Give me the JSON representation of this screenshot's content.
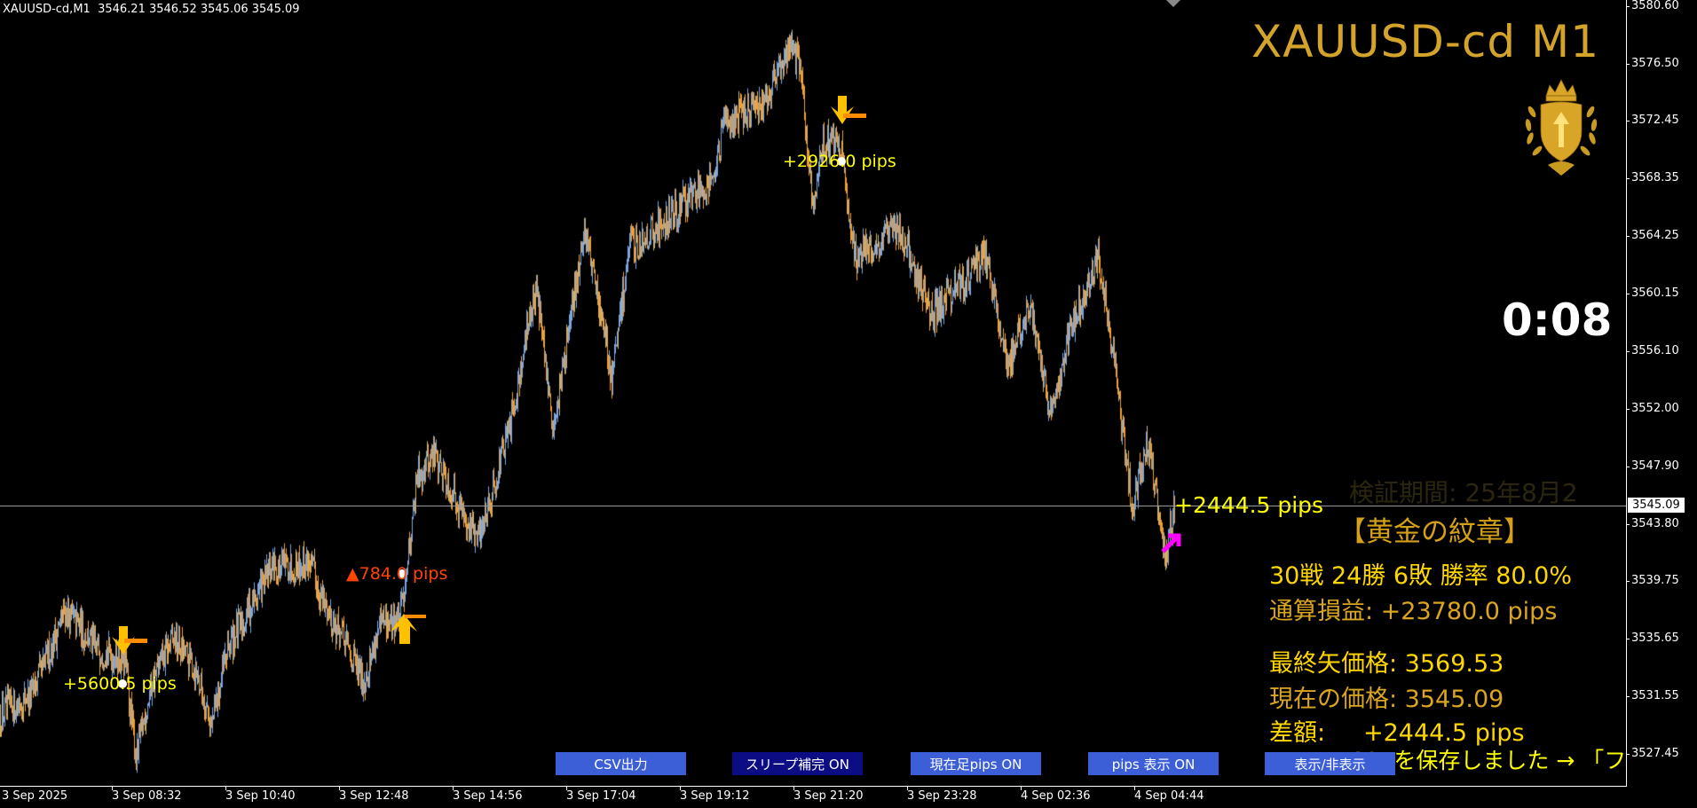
{
  "header": {
    "symbol": "XAUUSD-cd,M1",
    "ohlc": "3546.21 3546.52 3545.06 3545.09"
  },
  "title": "XAUUSD-cd M1",
  "timer": "0:08",
  "current_price": "3545.09",
  "price_axis": [
    "3580.60",
    "3576.50",
    "3572.45",
    "3568.35",
    "3564.25",
    "3560.15",
    "3556.10",
    "3552.00",
    "3547.90",
    "3543.80",
    "3539.75",
    "3535.65",
    "3531.55",
    "3527.45"
  ],
  "time_axis": [
    "3 Sep 2025",
    "3 Sep 08:32",
    "3 Sep 10:40",
    "3 Sep 12:48",
    "3 Sep 14:56",
    "3 Sep 17:04",
    "3 Sep 19:12",
    "3 Sep 21:20",
    "3 Sep 23:28",
    "4 Sep 02:36",
    "4 Sep 04:44"
  ],
  "signals": [
    {
      "type": "sell",
      "label": "+5600.5 pips",
      "color": "#ffff00"
    },
    {
      "type": "buy",
      "label": "▲784.0 pips",
      "color": "#ff4500"
    },
    {
      "type": "sell",
      "label": "+2926.0 pips",
      "color": "#ffff00"
    },
    {
      "type": "current",
      "label": "+2444.5 pips",
      "color": "#ffff00"
    }
  ],
  "faded_text": "検証期間: 25年8月2",
  "panel": {
    "heading": "【黄金の紋章】",
    "record": "30戦 24勝 6敗  勝率 80.0%",
    "total": "通算損益:  +23780.0 pips",
    "last_arrow_price": "最終矢価格: 3569.53",
    "current_price": "現在の価格: 3545.09",
    "diff": "差額:     +2444.5 pips",
    "csv_message": "CSVを保存しました → 「ファイル"
  },
  "buttons": [
    {
      "label": "CSV出力",
      "active": false
    },
    {
      "label": "スリープ補完 ON",
      "active": true
    },
    {
      "label": "現在足pips ON",
      "active": false
    },
    {
      "label": "pips 表示  ON",
      "active": false
    },
    {
      "label": "表示/非表示",
      "active": false
    }
  ],
  "colors": {
    "up_bar": "#7ea6e0",
    "down_bar": "#f0a030",
    "gold": "#d4a42a",
    "yellow": "#ffd700",
    "button": "#3c5fd8",
    "button_active": "#0c0c84",
    "buy_arrow": "#ffc000",
    "entry_arrow": "#ff00ff"
  },
  "chart_data": {
    "type": "candlestick",
    "ylim": [
      3525.4,
      3580.6
    ],
    "x_unit": "bar (M1)",
    "points": [
      [
        0,
        3530.3
      ],
      [
        37,
        3531.8
      ],
      [
        73,
        3537.6
      ],
      [
        110,
        3534.9
      ],
      [
        140,
        3534.1
      ],
      [
        153,
        3527.2
      ],
      [
        171,
        3532.6
      ],
      [
        195,
        3535.6
      ],
      [
        220,
        3533.4
      ],
      [
        238,
        3529.5
      ],
      [
        256,
        3534.9
      ],
      [
        305,
        3540.6
      ],
      [
        348,
        3541.1
      ],
      [
        366,
        3538.0
      ],
      [
        409,
        3532.6
      ],
      [
        427,
        3536.4
      ],
      [
        451,
        3537.2
      ],
      [
        470,
        3547.2
      ],
      [
        488,
        3548.8
      ],
      [
        537,
        3542.6
      ],
      [
        573,
        3550.3
      ],
      [
        604,
        3561.1
      ],
      [
        622,
        3550.3
      ],
      [
        659,
        3564.9
      ],
      [
        689,
        3554.1
      ],
      [
        708,
        3563.3
      ],
      [
        756,
        3565.7
      ],
      [
        805,
        3568.7
      ],
      [
        817,
        3572.6
      ],
      [
        854,
        3573.3
      ],
      [
        891,
        3578.0
      ],
      [
        903,
        3575.7
      ],
      [
        915,
        3565.7
      ],
      [
        927,
        3571.0
      ],
      [
        946,
        3571.0
      ],
      [
        964,
        3562.6
      ],
      [
        1013,
        3564.9
      ],
      [
        1049,
        3558.7
      ],
      [
        1074,
        3560.3
      ],
      [
        1110,
        3562.9
      ],
      [
        1135,
        3554.9
      ],
      [
        1159,
        3559.5
      ],
      [
        1183,
        3551.8
      ],
      [
        1208,
        3558.0
      ],
      [
        1238,
        3562.6
      ],
      [
        1257,
        3554.1
      ],
      [
        1275,
        3544.9
      ],
      [
        1293,
        3549.9
      ],
      [
        1312,
        3541.1
      ],
      [
        1324,
        3545.09
      ]
    ]
  }
}
